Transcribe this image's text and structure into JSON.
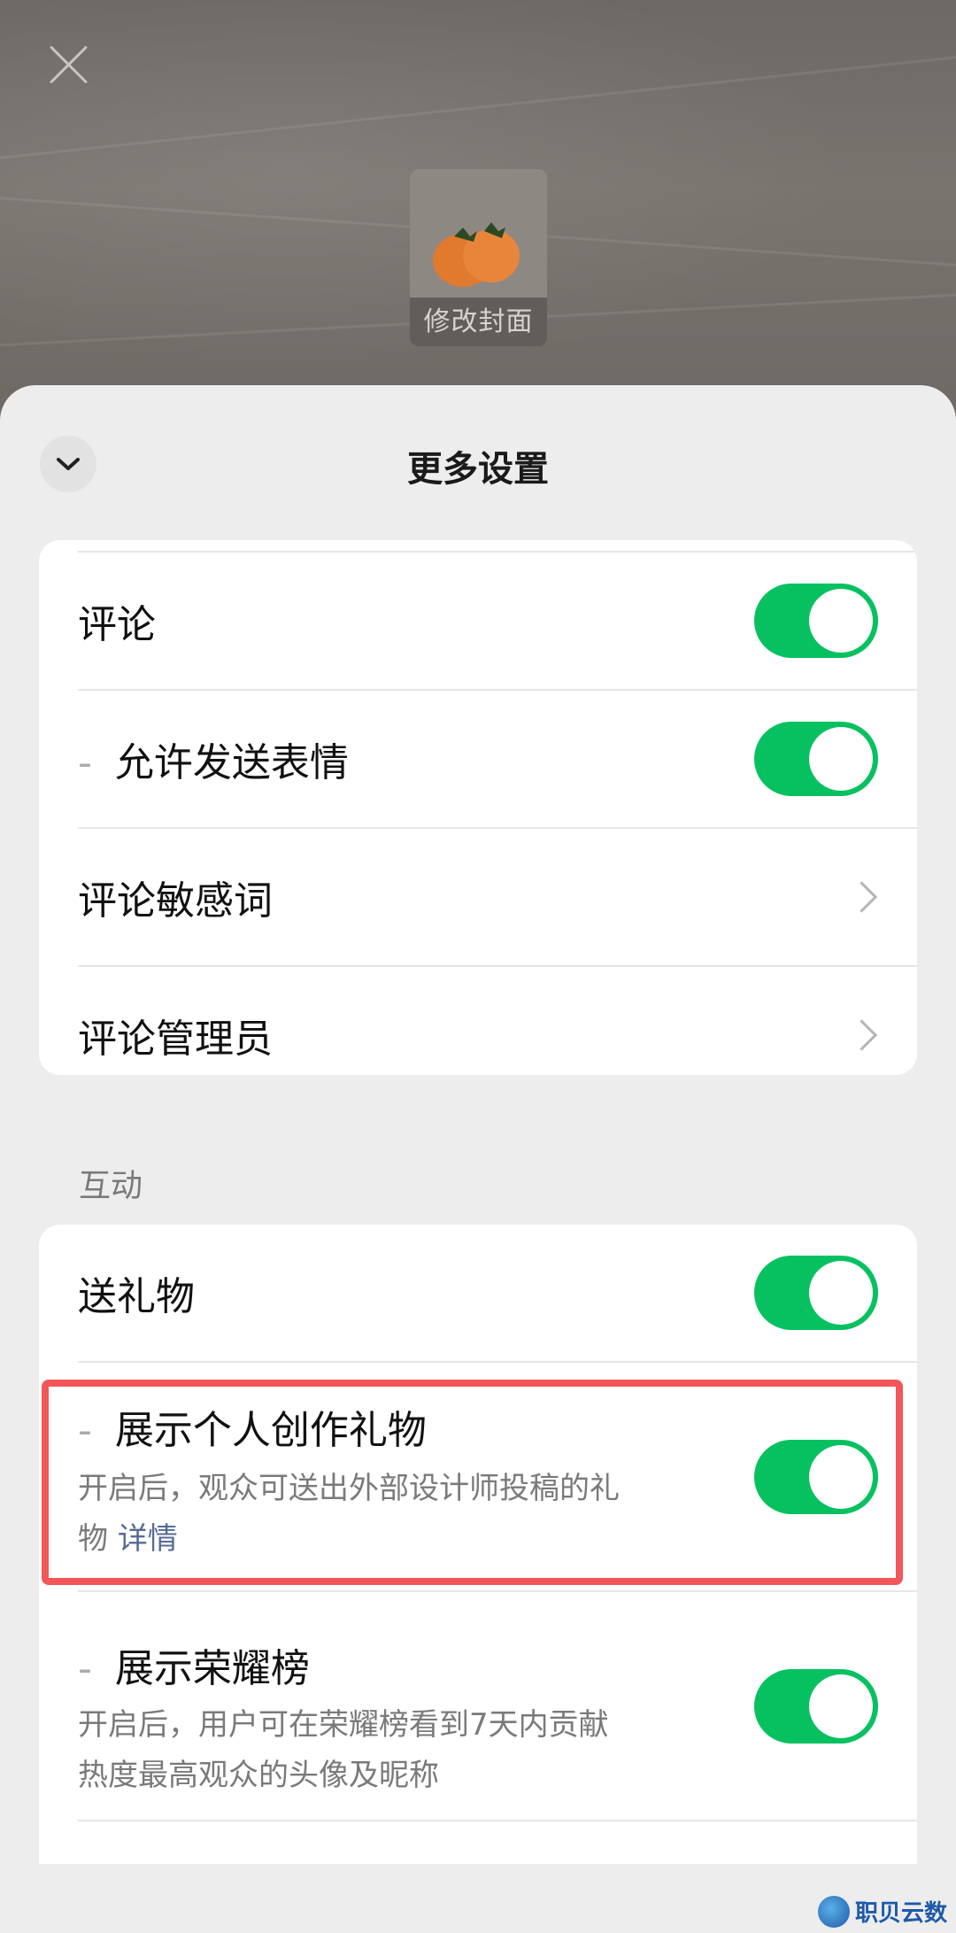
{
  "cover": {
    "label": "修改封面"
  },
  "sheet": {
    "title": "更多设置"
  },
  "comments_card": {
    "rows": [
      {
        "label": "评论",
        "toggle": true
      },
      {
        "label": "允许发送表情",
        "toggle": true,
        "dash": "-"
      },
      {
        "label": "评论敏感词",
        "chevron": true
      },
      {
        "label": "评论管理员",
        "chevron": true
      }
    ]
  },
  "interaction": {
    "section_label": "互动",
    "rows": [
      {
        "label": "送礼物",
        "toggle": true
      },
      {
        "label": "展示个人创作礼物",
        "dash": "-",
        "desc": "开启后，观众可送出外部设计师投稿的礼",
        "desc2_prefix": "物 ",
        "desc2_link": "详情",
        "toggle": true
      },
      {
        "label": "展示荣耀榜",
        "dash": "-",
        "desc": "开启后，用户可在荣耀榜看到7天内贡献",
        "desc2": "热度最高观众的头像及昵称",
        "toggle": true
      }
    ]
  },
  "watermark": {
    "text": "职贝云数"
  },
  "colors": {
    "accent": "#07c160",
    "highlight": "#f2555a",
    "link": "#576b95"
  }
}
